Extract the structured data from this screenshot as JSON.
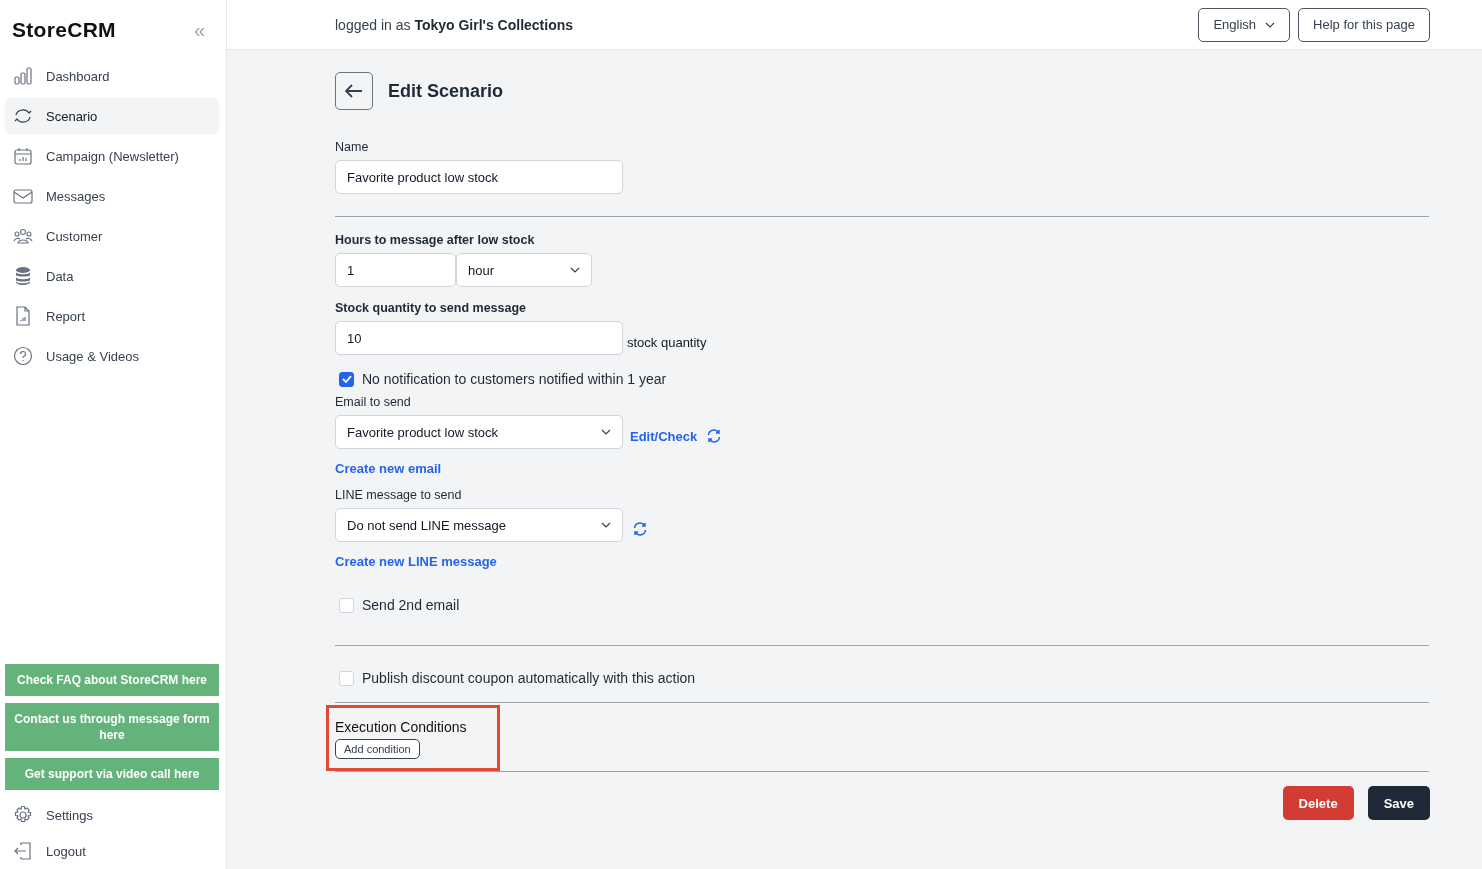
{
  "sidebar": {
    "logo": "StoreCRM",
    "collapse": "«",
    "items": [
      {
        "label": "Dashboard",
        "selected": false
      },
      {
        "label": "Scenario",
        "selected": true
      },
      {
        "label": "Campaign (Newsletter)",
        "selected": false
      },
      {
        "label": "Messages",
        "selected": false
      },
      {
        "label": "Customer",
        "selected": false
      },
      {
        "label": "Data",
        "selected": false
      },
      {
        "label": "Report",
        "selected": false
      },
      {
        "label": "Usage & Videos",
        "selected": false
      }
    ],
    "support_buttons": [
      "Check FAQ about StoreCRM here",
      "Contact us through message form here",
      "Get support via video call here"
    ],
    "bottom_items": [
      {
        "label": "Settings"
      },
      {
        "label": "Logout"
      }
    ]
  },
  "header": {
    "login_prefix": "logged in as",
    "user": "Tokyo Girl's Collections",
    "language": "English",
    "help": "Help for this page"
  },
  "page": {
    "title": "Edit Scenario",
    "name": {
      "label": "Name",
      "value": "Favorite product low stock"
    },
    "hours": {
      "label": "Hours to message after low stock",
      "value": "1",
      "unit": "hour"
    },
    "stock": {
      "label": "Stock quantity to send message",
      "value": "10",
      "suffix": "stock quantity"
    },
    "no_notification": {
      "label": "No notification to customers notified within 1 year",
      "checked": true
    },
    "email": {
      "label": "Email to send",
      "value": "Favorite product low stock",
      "edit_link": "Edit/Check",
      "create_link": "Create new email"
    },
    "line": {
      "label": "LINE message to send",
      "value": "Do not send LINE message",
      "create_link": "Create new LINE message"
    },
    "second_email": {
      "label": "Send 2nd email",
      "checked": false
    },
    "coupon": {
      "label": "Publish discount coupon automatically with this action",
      "checked": false
    },
    "conditions": {
      "title": "Execution Conditions",
      "button": "Add condition",
      "highlighted": true
    },
    "actions": {
      "delete": "Delete",
      "save": "Save"
    }
  }
}
